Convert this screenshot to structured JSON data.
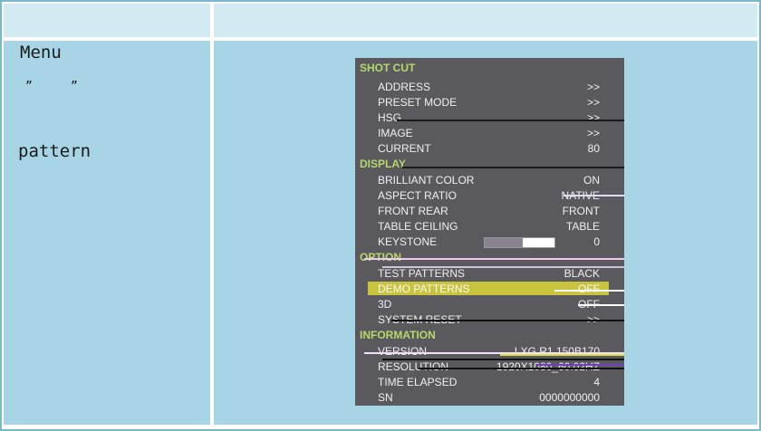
{
  "left": {
    "menu_word": "Menu",
    "quote_open": "”",
    "quote_close": "”",
    "pattern_word": "pattern"
  },
  "osd": {
    "sections": {
      "shortcut": "SHOT CUT",
      "display": "DISPLAY",
      "option": "OPTION",
      "information": "INFORMATION"
    },
    "shortcut_items": [
      {
        "label": "ADDRESS",
        "value": ">>"
      },
      {
        "label": "PRESET MODE",
        "value": ">>"
      },
      {
        "label": "HSG",
        "value": ">>"
      },
      {
        "label": "IMAGE",
        "value": ">>"
      },
      {
        "label": "CURRENT",
        "value": "80"
      }
    ],
    "display_items": [
      {
        "label": "BRILLIANT COLOR",
        "value": "ON"
      },
      {
        "label": "ASPECT RATIO",
        "value": "NATIVE"
      },
      {
        "label": "FRONT REAR",
        "value": "FRONT"
      },
      {
        "label": "TABLE CEILING",
        "value": "TABLE"
      },
      {
        "label": "KEYSTONE",
        "value": "0"
      }
    ],
    "keystone_fill": 0.55,
    "option_items": [
      {
        "label": "TEST PATTERNS",
        "value": "BLACK"
      },
      {
        "label": "DEMO PATTERNS",
        "value": "OFF"
      },
      {
        "label": "3D",
        "value": "OFF"
      },
      {
        "label": "SYSTEM RESET",
        "value": ">>"
      }
    ],
    "selected_item": "DEMO PATTERNS",
    "information_items": [
      {
        "label": "VERSION",
        "value": "LXG.R1.150B170"
      },
      {
        "label": "RESOLUTION",
        "value": "1920X1080_60.02HZ"
      },
      {
        "label": "TIME ELAPSED",
        "value": "4"
      },
      {
        "label": "SN",
        "value": "0000000000"
      }
    ]
  },
  "colors": {
    "section_green": "#b5d86a",
    "panel_gray": "#5a5a5e",
    "selection_yellow": "#c9c43e",
    "cell_blue": "#a8d5e5"
  }
}
